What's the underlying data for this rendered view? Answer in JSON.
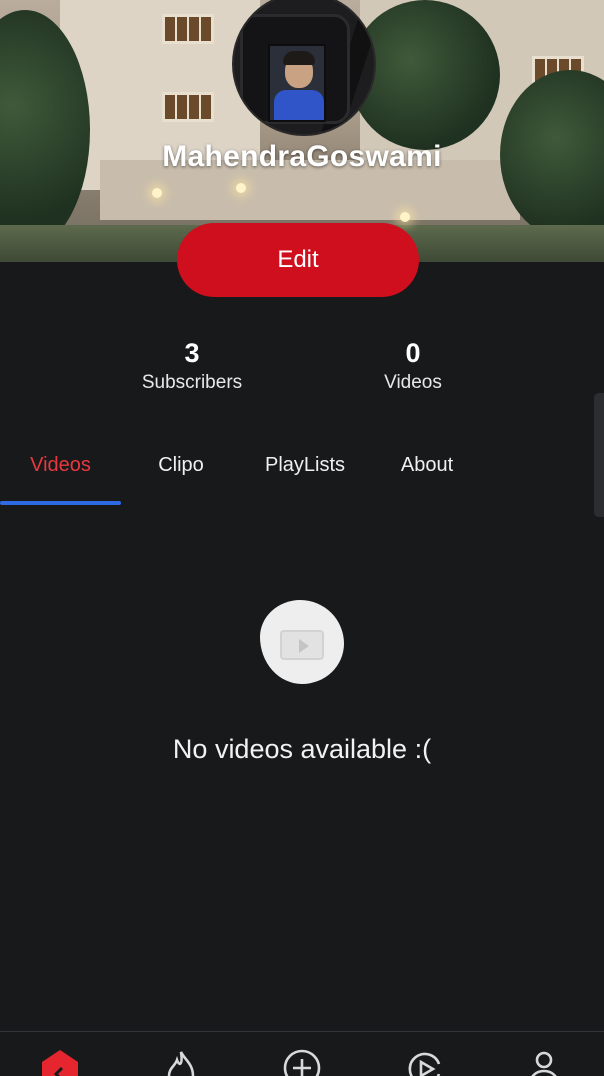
{
  "profile": {
    "username": "MahendraGoswami",
    "edit_label": "Edit"
  },
  "stats": {
    "subscribers_count": "3",
    "subscribers_label": "Subscribers",
    "videos_count": "0",
    "videos_label": "Videos"
  },
  "tabs": [
    {
      "label": "Videos",
      "active": true
    },
    {
      "label": "Clipo",
      "active": false
    },
    {
      "label": "PlayLists",
      "active": false
    },
    {
      "label": "About",
      "active": false
    }
  ],
  "empty_state": {
    "message": "No videos available :(",
    "icon": "video-placeholder-icon"
  },
  "bottom_nav": [
    {
      "icon": "home-icon",
      "active": true
    },
    {
      "icon": "trending-flame-icon",
      "active": false
    },
    {
      "icon": "add-circle-icon",
      "active": false
    },
    {
      "icon": "subscriptions-play-icon",
      "active": false
    },
    {
      "icon": "profile-icon",
      "active": false
    }
  ],
  "colors": {
    "background": "#18191b",
    "accent_red": "#cf0f1e",
    "active_tab_text": "#e8383f",
    "tab_underline": "#2d6ae3"
  }
}
